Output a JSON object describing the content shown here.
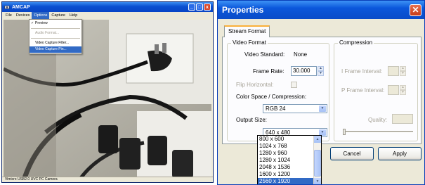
{
  "amcap": {
    "title": "AMCAP",
    "controls": {
      "minimize": "_",
      "maximize": "□",
      "close": "x"
    },
    "menu": [
      "File",
      "Devices",
      "Options",
      "Capture",
      "Help"
    ],
    "active_menu": "Options",
    "options_menu": [
      {
        "label": "Preview",
        "checked": "✓",
        "state": "normal"
      },
      {
        "label": "Audio Format...",
        "state": "disabled"
      },
      {
        "label": "Video Capture Filter...",
        "state": "normal"
      },
      {
        "label": "Video Capture Pin...",
        "state": "highlight"
      }
    ],
    "status": "Vimicro USB2.0 UVC PC Camera"
  },
  "properties": {
    "title": "Properties",
    "close": "✕",
    "tab": "Stream Format",
    "video_format": {
      "legend": "Video Format",
      "video_standard_label": "Video Standard:",
      "video_standard_value": "None",
      "frame_rate_label": "Frame Rate:",
      "frame_rate_value": "30.000",
      "flip_horizontal_label": "Flip Horizontal:",
      "color_space_label": "Color Space / Compression:",
      "color_space_value": "RGB 24",
      "output_size_label": "Output Size:",
      "output_size_value": "640 x 480",
      "output_size_options": [
        "800 x 600",
        "1024 x 768",
        "1280 x 960",
        "1280 x 1024",
        "2048 x 1536",
        "1600 x 1200",
        "2560 x 1920"
      ],
      "selected_option": "2560 x 1920"
    },
    "compression": {
      "legend": "Compression",
      "i_frame_label": "I Frame Interval:",
      "p_frame_label": "P Frame Interval:",
      "quality_label": "Quality:"
    },
    "buttons": {
      "cancel": "Cancel",
      "apply": "Apply"
    }
  },
  "colors": {
    "titlebar_blue": "#0a4fd0",
    "selection_blue": "#316ac5",
    "close_red": "#c63c18",
    "dialog_face": "#ece9d8"
  }
}
